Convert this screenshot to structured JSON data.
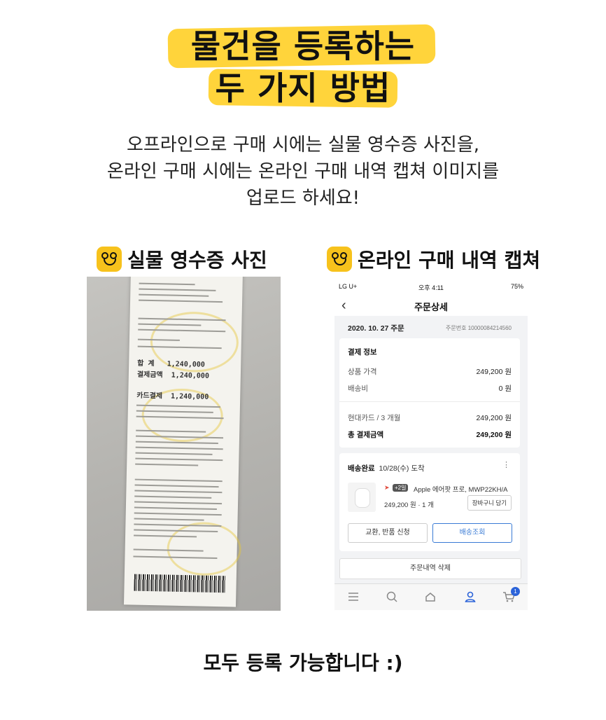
{
  "headline": {
    "line1": "물건을 등록하는",
    "line2": "두 가지 방법"
  },
  "intro": {
    "line1": "오프라인으로 구매 시에는 실물 영수증 사진을,",
    "line2": "온라인 구매 시에는 온라인 구매 내역 캡쳐 이미지를",
    "line3": "업로드 하세요!"
  },
  "sections": {
    "left": "실물 영수증 사진",
    "right": "온라인 구매 내역 캡쳐"
  },
  "receipt": {
    "total_label": "합 계",
    "total_value": "1,240,000",
    "paid_label": "결제금액",
    "paid_value": "1,240,000",
    "card_label": "카드결제",
    "card_value": "1,240,000"
  },
  "phone": {
    "status": {
      "carrier": "LG U+",
      "time": "오후 4:11",
      "battery": "75%"
    },
    "title": "주문상세",
    "order": {
      "date": "2020. 10. 27 주문",
      "number": "주문번호 10000084214560"
    },
    "payment": {
      "header": "결제 정보",
      "rows": [
        {
          "label": "상품 가격",
          "value": "249,200 원"
        },
        {
          "label": "배송비",
          "value": "0 원"
        },
        {
          "label": "현대카드 / 3 개월",
          "value": "249,200 원"
        },
        {
          "label": "총 결제금액",
          "value": "249,200 원"
        }
      ]
    },
    "delivery": {
      "status": "배송완료",
      "date": "10/28(수) 도착",
      "tag": "+2일",
      "product": "Apple 에어팟 프로, MWP22KH/A",
      "price_qty": "249,200 원 · 1 개",
      "cart_button": "장바구니 담기",
      "exchange_button": "교환, 반품 신청",
      "tracking_button": "배송조회"
    },
    "delete_button": "주문내역 삭제",
    "cart_count": "1"
  },
  "footer": "모두 등록 가능합니다 :)",
  "colors": {
    "highlight": "#ffd43b",
    "badge": "#f7c21c",
    "accent_blue": "#3a7bd5"
  }
}
